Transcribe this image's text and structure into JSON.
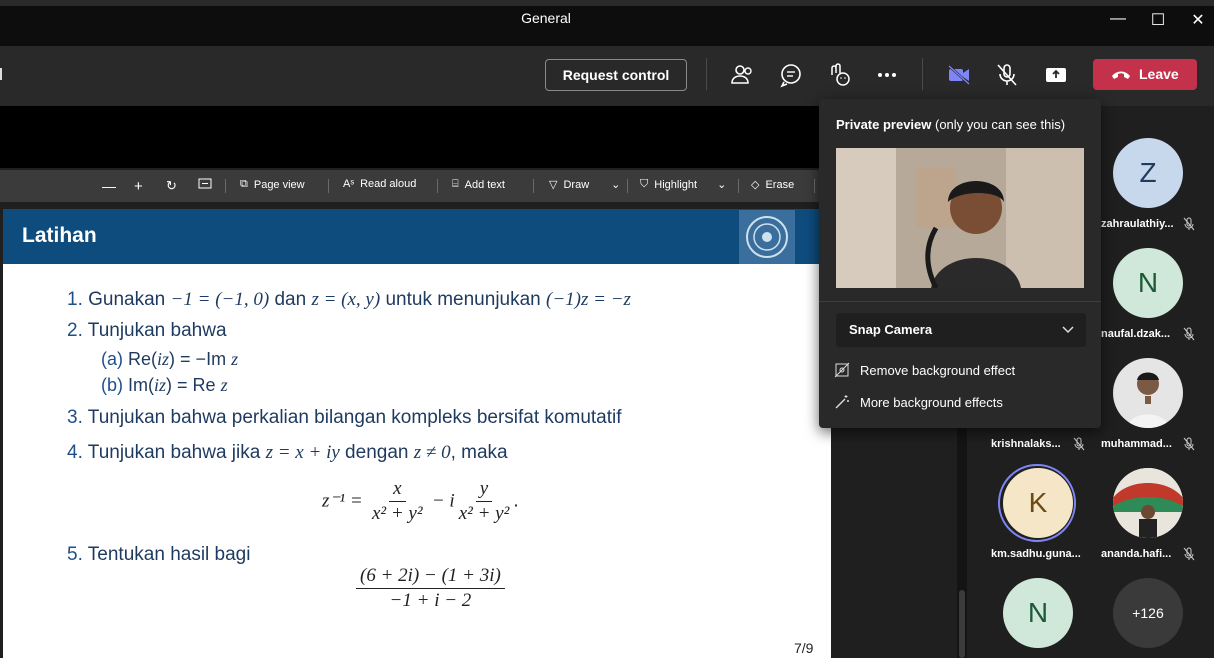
{
  "window": {
    "title": "General"
  },
  "toolbar": {
    "request_control": "Request control",
    "leave": "Leave",
    "icons": [
      "people-icon",
      "chat-icon",
      "reactions-icon",
      "more-icon",
      "camera-icon",
      "mic-off-icon",
      "share-icon",
      "phone-hangup-icon"
    ]
  },
  "pdf_toolbar": {
    "page_view": "Page view",
    "read_aloud": "Read aloud",
    "add_text": "Add text",
    "draw": "Draw",
    "highlight": "Highlight",
    "erase": "Erase"
  },
  "slide": {
    "title": "Latihan",
    "page": "7/9",
    "items": {
      "n1": "1.",
      "t1a": "Gunakan ",
      "m1a": "−1 = (−1, 0)",
      "t1b": " dan ",
      "m1b": "z = (x, y)",
      "t1c": " untuk menunjukan ",
      "m1c": "(−1)z = −z",
      "n2": "2.",
      "t2": "Tunjukan bahwa",
      "n2a": "(a)",
      "t2a": "Re(",
      "m2a": "iz",
      "t2a2": ") = −Im ",
      "m2a2": "z",
      "n2b": "(b)",
      "t2b": "Im(",
      "m2b": "iz",
      "t2b2": ") = Re ",
      "m2b2": "z",
      "n3": "3.",
      "t3": "Tunjukan bahwa perkalian bilangan kompleks bersifat komutatif",
      "n4": "4.",
      "t4a": "Tunjukan bahwa jika ",
      "m4a": "z = x + iy",
      "t4b": " dengan ",
      "m4b": "z ≠ 0",
      "t4c": ", maka",
      "eq4_lhs": "z⁻¹ =",
      "eq4_n1": "x",
      "eq4_d1": "x² + y²",
      "eq4_mid": "− i",
      "eq4_n2": "y",
      "eq4_d2": "x² + y²",
      "eq4_end": ".",
      "n5": "5.",
      "t5": "Tentukan hasil bagi",
      "eq5_n": "(6 + 2i) − (1 + 3i)",
      "eq5_d": "−1 + i − 2"
    }
  },
  "preview": {
    "title_bold": "Private preview",
    "title_rest": " (only you can see this)",
    "camera_select": "Snap Camera",
    "remove_bg": "Remove background effect",
    "more_bg": "More background effects"
  },
  "participants": [
    {
      "name": "zahraulathiy...",
      "initial": "Z",
      "color": "#c7d7ec",
      "text_color": "#1f3b5e"
    },
    {
      "name": "naufal.dzak...",
      "initial": "N",
      "color": "#cfe8d9",
      "text_color": "#1e5a37"
    },
    {
      "name": "muhammad...",
      "initial": "",
      "color": "#d8d8d8",
      "text_color": "#333"
    },
    {
      "name": "krishnalaks...",
      "initial": "",
      "color": "#2a2a2a",
      "text_color": "#fff"
    },
    {
      "name": "km.sadhu.guna...",
      "initial": "K",
      "color": "#f5e6c8",
      "text_color": "#6b4a14"
    },
    {
      "name": "ananda.hafi...",
      "initial": "",
      "color": "#d6d6d6",
      "text_color": "#333"
    },
    {
      "name": "",
      "initial": "N",
      "color": "#cfe8d9",
      "text_color": "#1e5a37"
    },
    {
      "name": "",
      "initial": "+126",
      "color": "#3a3a3a",
      "text_color": "#fff"
    }
  ],
  "colors": {
    "leave": "#c4314b",
    "slide_header": "#0e4c7e",
    "camera_on": "#7f85f5"
  }
}
